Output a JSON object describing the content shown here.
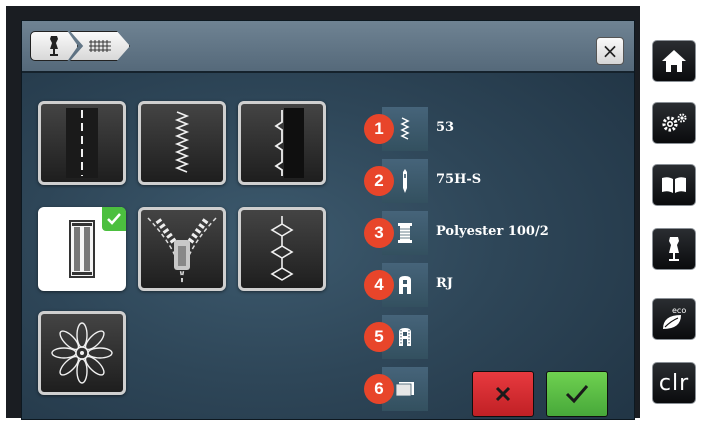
{
  "header": {
    "close_label": "×"
  },
  "tiles": [
    {
      "name": "straight-stitch",
      "selected": false
    },
    {
      "name": "zigzag-stitch",
      "selected": false
    },
    {
      "name": "blind-stitch",
      "selected": false
    },
    {
      "name": "buttonhole",
      "selected": true
    },
    {
      "name": "zipper",
      "selected": false
    },
    {
      "name": "decorative-stitch",
      "selected": false
    },
    {
      "name": "embroidery-flower",
      "selected": false
    }
  ],
  "info": [
    {
      "number": "1",
      "icon": "stitch-icon",
      "value": "53"
    },
    {
      "number": "2",
      "icon": "needle-icon",
      "value": "75H-S"
    },
    {
      "number": "3",
      "icon": "thread-spool-icon",
      "value": "Polyester 100/2"
    },
    {
      "number": "4",
      "icon": "presser-foot-icon",
      "value": "RJ"
    },
    {
      "number": "5",
      "icon": "presser-foot-alt-icon",
      "value": ""
    },
    {
      "number": "6",
      "icon": "stabilizer-icon",
      "value": ""
    }
  ],
  "sidebar": {
    "clr_label": "clr",
    "eco_label": "eco"
  },
  "colors": {
    "cancel": "#d62b30",
    "confirm": "#5cc145",
    "badge": "#e8452a",
    "check": "#4cbf3f"
  }
}
